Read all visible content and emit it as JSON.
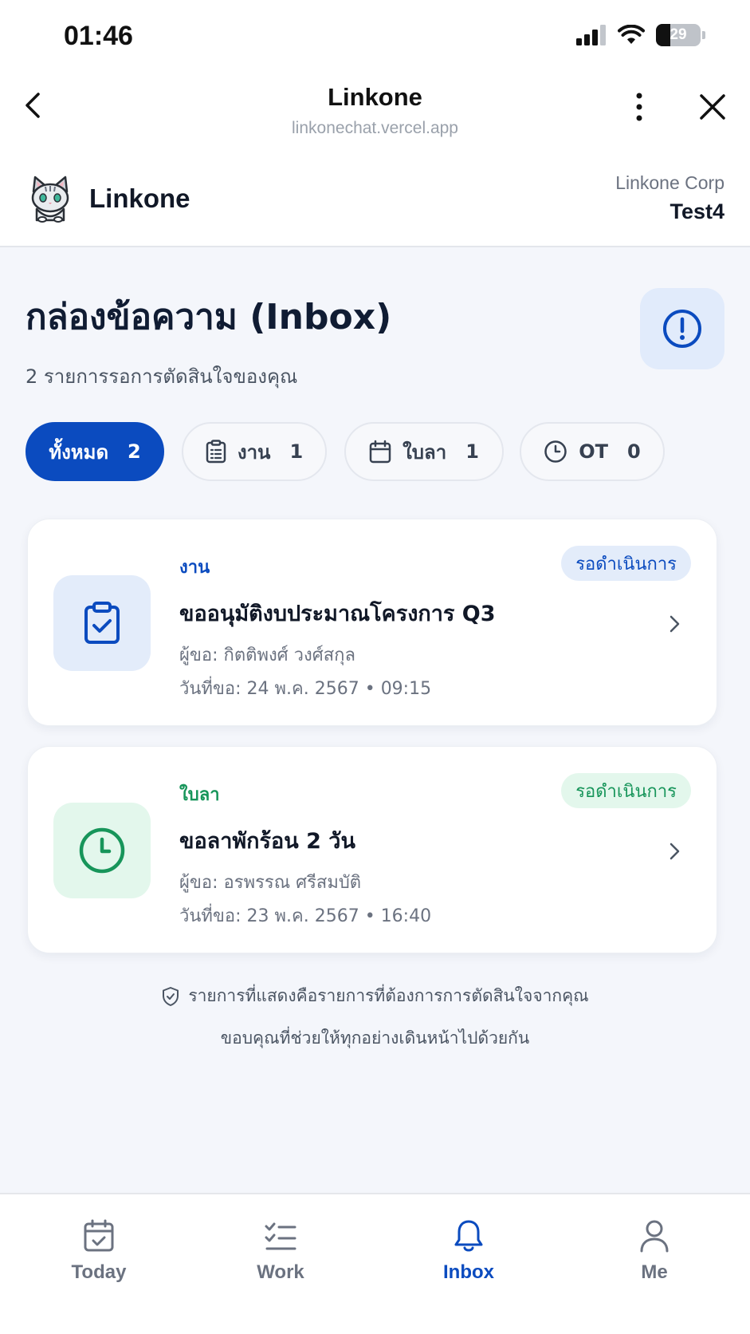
{
  "status_bar": {
    "time": "01:46",
    "battery": "29"
  },
  "browser": {
    "title": "Linkone",
    "url": "linkonechat.vercel.app"
  },
  "app_header": {
    "brand": "Linkone",
    "org": "Linkone Corp",
    "user": "Test4",
    "logo_icon": "cat-mascot-icon"
  },
  "page": {
    "title": "กล่องข้อความ (Inbox)",
    "subtitle": "2 รายการรอการตัดสินใจของคุณ",
    "alert_icon": "alert-circle-icon"
  },
  "filters": [
    {
      "label": "ทั้งหมด",
      "count": "2",
      "icon": "",
      "active": true
    },
    {
      "label": "งาน",
      "count": "1",
      "icon": "clipboard-list-icon",
      "active": false
    },
    {
      "label": "ใบลา",
      "count": "1",
      "icon": "calendar-icon",
      "active": false
    },
    {
      "label": "OT",
      "count": "0",
      "icon": "clock-icon",
      "active": false
    }
  ],
  "items": [
    {
      "category": "งาน",
      "status": "รอดำเนินการ",
      "title": "ขออนุมัติงบประมาณโครงการ Q3",
      "requester": "ผู้ขอ: กิตติพงศ์ วงศ์สกุล",
      "date": "วันที่ขอ: 24 พ.ค. 2567 • 09:15",
      "icon": "clipboard-check-icon",
      "accent": "#0b4bbf",
      "icon_bg": "#e3ecfa",
      "badge_bg": "#e3ecfa"
    },
    {
      "category": "ใบลา",
      "status": "รอดำเนินการ",
      "title": "ขอลาพักร้อน 2 วัน",
      "requester": "ผู้ขอ: อรพรรณ ศรีสมบัติ",
      "date": "วันที่ขอ: 23 พ.ค. 2567 • 16:40",
      "icon": "clock-icon",
      "accent": "#17955a",
      "icon_bg": "#e3f7ec",
      "badge_bg": "#e3f7ec"
    }
  ],
  "footer": {
    "line1": "รายการที่แสดงคือรายการที่ต้องการการตัดสินใจจากคุณ",
    "line2": "ขอบคุณที่ช่วยให้ทุกอย่างเดินหน้าไปด้วยกัน"
  },
  "bottom_nav": [
    {
      "label": "Today",
      "icon": "calendar-check-icon",
      "active": false
    },
    {
      "label": "Work",
      "icon": "checklist-icon",
      "active": false
    },
    {
      "label": "Inbox",
      "icon": "bell-icon",
      "active": true
    },
    {
      "label": "Me",
      "icon": "user-icon",
      "active": false
    }
  ],
  "colors": {
    "primary": "#0b4bbf",
    "success": "#17955a",
    "background": "#f4f6fb"
  }
}
